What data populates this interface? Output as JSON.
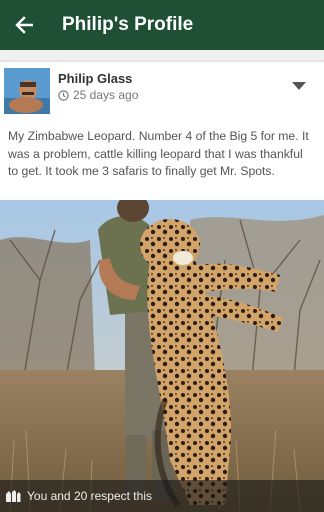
{
  "header": {
    "title": "Philip's Profile",
    "back_icon": "arrow-left-icon",
    "background_color": "#1f4f35"
  },
  "post": {
    "author": "Philip Glass",
    "time": "25 days ago",
    "time_icon": "clock-icon",
    "menu_icon": "chevron-down-icon",
    "text": "My Zimbabwe Leopard. Number 4 of the Big 5 for me. It was a problem, cattle killing leopard that I was thankful to get. It took me 3 safaris to finally get Mr. Spots.",
    "respect_icon": "respect-hands-icon",
    "respect_text": "You and 20 respect this"
  }
}
